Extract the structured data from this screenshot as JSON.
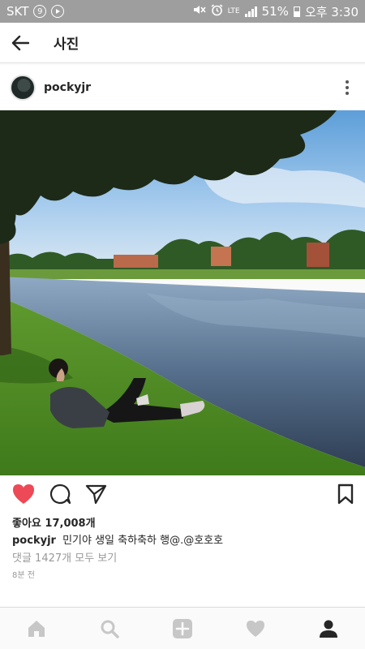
{
  "status_bar": {
    "carrier": "SKT",
    "carrier_badge": "9",
    "network": "LTE",
    "battery": "51%",
    "time": "오후 3:30"
  },
  "header": {
    "title": "사진",
    "back_icon": "arrow-left-icon"
  },
  "post": {
    "username": "pockyjr",
    "likes_label": "좋아요",
    "likes_count": "17,008개",
    "caption_user": "pockyjr",
    "caption_text": "민기야 생일 축하축하 행@.@호호호",
    "comments_link": "댓글 1427개 모두 보기",
    "time_ago": "8분 전",
    "liked": true
  },
  "colors": {
    "like_red": "#ed4956",
    "status_bar": "#9e9e9e",
    "text_dark": "#262626",
    "text_muted": "#999999",
    "nav_inactive": "#c7c7c7"
  },
  "bottom_nav": {
    "items": [
      "home-icon",
      "search-icon",
      "add-post-icon",
      "activity-heart-icon",
      "profile-icon"
    ]
  }
}
